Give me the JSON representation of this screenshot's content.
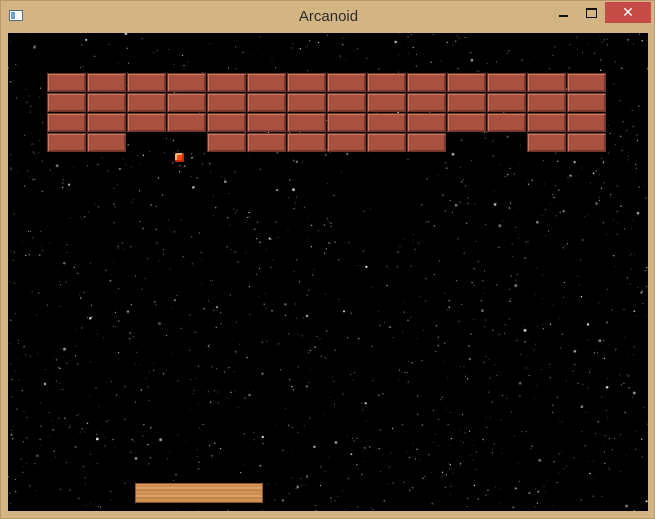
{
  "window": {
    "title": "Arcanoid",
    "close_glyph": "✕"
  },
  "game": {
    "brick_color": "#a8513e",
    "ball_color": "#ff4a12",
    "background": "starfield",
    "brick_rows": [
      [
        1,
        1,
        1,
        1,
        1,
        1,
        1,
        1,
        1,
        1,
        1,
        1,
        1,
        1
      ],
      [
        1,
        1,
        1,
        1,
        1,
        1,
        1,
        1,
        1,
        1,
        1,
        1,
        1,
        1
      ],
      [
        1,
        1,
        1,
        1,
        1,
        1,
        1,
        1,
        1,
        1,
        1,
        1,
        1,
        1
      ],
      [
        1,
        1,
        0,
        0,
        1,
        1,
        1,
        1,
        1,
        1,
        0,
        0,
        1,
        1
      ]
    ]
  }
}
